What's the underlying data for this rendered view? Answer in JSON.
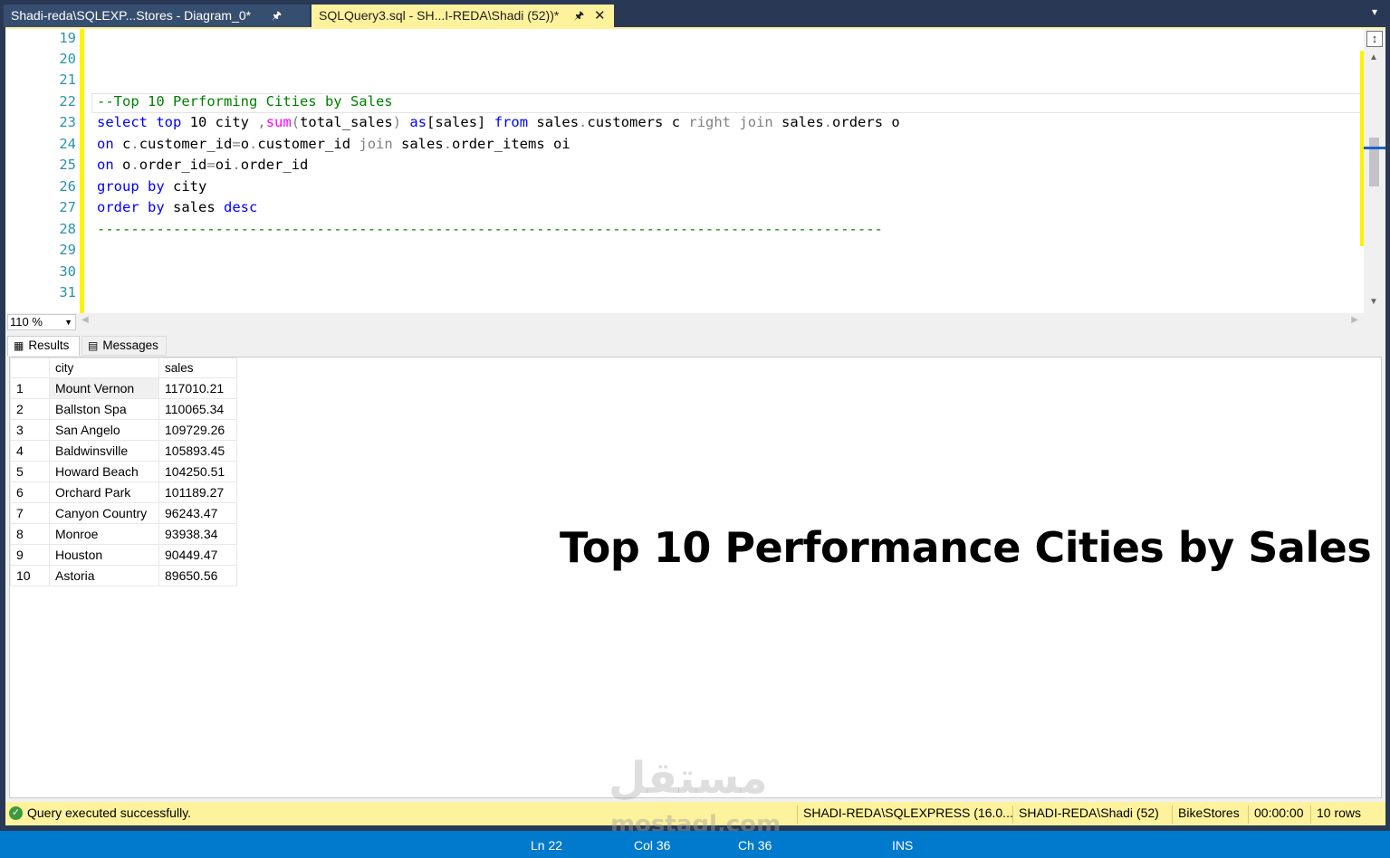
{
  "tabs": [
    {
      "label": "Shadi-reda\\SQLEXP...Stores - Diagram_0*",
      "active": false
    },
    {
      "label": "SQLQuery3.sql - SH...I-REDA\\Shadi (52))*",
      "active": true
    }
  ],
  "editor": {
    "line_numbers": [
      "19",
      "20",
      "21",
      "22",
      "23",
      "24",
      "25",
      "26",
      "27",
      "28",
      "29",
      "30",
      "31"
    ],
    "comment": "--Top 10 Performing Cities by Sales",
    "separator": "---------------------------------------------------------------------------------------------"
  },
  "zoom": {
    "value": "110 %"
  },
  "results_tabs": {
    "results": "Results",
    "messages": "Messages"
  },
  "grid": {
    "headers": [
      "city",
      "sales"
    ],
    "rows": [
      {
        "idx": "1",
        "city": "Mount Vernon",
        "sales": "117010.21"
      },
      {
        "idx": "2",
        "city": "Ballston Spa",
        "sales": "110065.34"
      },
      {
        "idx": "3",
        "city": "San Angelo",
        "sales": "109729.26"
      },
      {
        "idx": "4",
        "city": "Baldwinsville",
        "sales": "105893.45"
      },
      {
        "idx": "5",
        "city": "Howard Beach",
        "sales": "104250.51"
      },
      {
        "idx": "6",
        "city": "Orchard Park",
        "sales": "101189.27"
      },
      {
        "idx": "7",
        "city": "Canyon Country",
        "sales": "96243.47"
      },
      {
        "idx": "8",
        "city": "Monroe",
        "sales": "93938.34"
      },
      {
        "idx": "9",
        "city": "Houston",
        "sales": "90449.47"
      },
      {
        "idx": "10",
        "city": "Astoria",
        "sales": "89650.56"
      }
    ]
  },
  "overlay_title": "Top 10 Performance Cities by Sales",
  "watermark": {
    "arabic": "مستقل",
    "latin": "mostaql.com"
  },
  "status": {
    "message": "Query executed successfully.",
    "server": "SHADI-REDA\\SQLEXPRESS (16.0...",
    "user": "SHADI-REDA\\Shadi (52)",
    "database": "BikeStores",
    "elapsed": "00:00:00",
    "rows": "10 rows"
  },
  "position_bar": {
    "line": "Ln 22",
    "col": "Col 36",
    "ch": "Ch 36",
    "mode": "INS"
  },
  "colors": {
    "accent_yellow": "#fff29d",
    "status_blue": "#007acc",
    "keyword": "#0000ff",
    "function": "#ff00ff",
    "comment": "#008000"
  }
}
